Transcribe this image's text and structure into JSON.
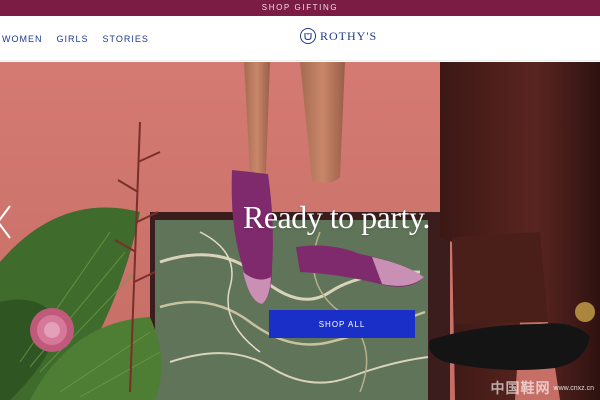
{
  "promo": {
    "label": "SHOP GIFTING"
  },
  "nav": {
    "links": [
      "WOMEN",
      "GIRLS",
      "STORIES"
    ]
  },
  "brand": {
    "name": "ROTHY'S",
    "icon": "shoe-logo-icon"
  },
  "hero": {
    "headline": "Ready to party.",
    "cta_label": "SHOP ALL",
    "prev_icon": "chevron-left-icon"
  },
  "watermark": {
    "text": "中国鞋网",
    "url": "www.cnxz.cn"
  },
  "colors": {
    "promo_bg": "#7a1c44",
    "brand": "#1f3a8a",
    "cta_bg": "#1a2fc7",
    "wall": "#d8867c",
    "shoe_purple": "#7e2a6d"
  }
}
